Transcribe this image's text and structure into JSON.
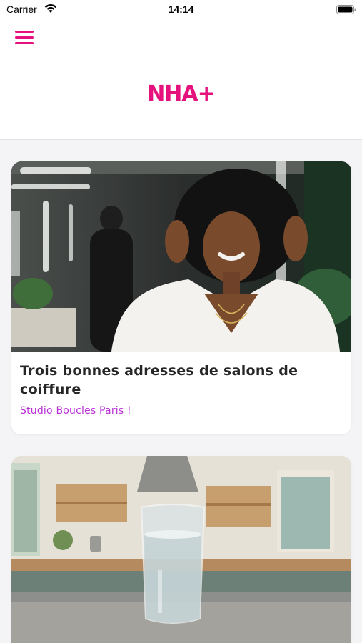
{
  "status_bar": {
    "carrier": "Carrier",
    "time": "14:14",
    "icons": [
      "wifi-icon",
      "battery-icon"
    ]
  },
  "header": {
    "menu_icon": "hamburger-menu-icon",
    "logo_text": "NHA+",
    "brand_color": "#e5117d"
  },
  "articles": [
    {
      "image": "woman-with-afro-hair-in-salon-photo",
      "title": "Trois bonnes adresses de salons de coiffure",
      "subtitle": "Studio Boucles Paris !"
    },
    {
      "image": "glass-of-water-in-kitchen-photo"
    }
  ],
  "colors": {
    "accent": "#e5117d",
    "subtitle": "#b930d6",
    "background": "#f4f4f6"
  }
}
